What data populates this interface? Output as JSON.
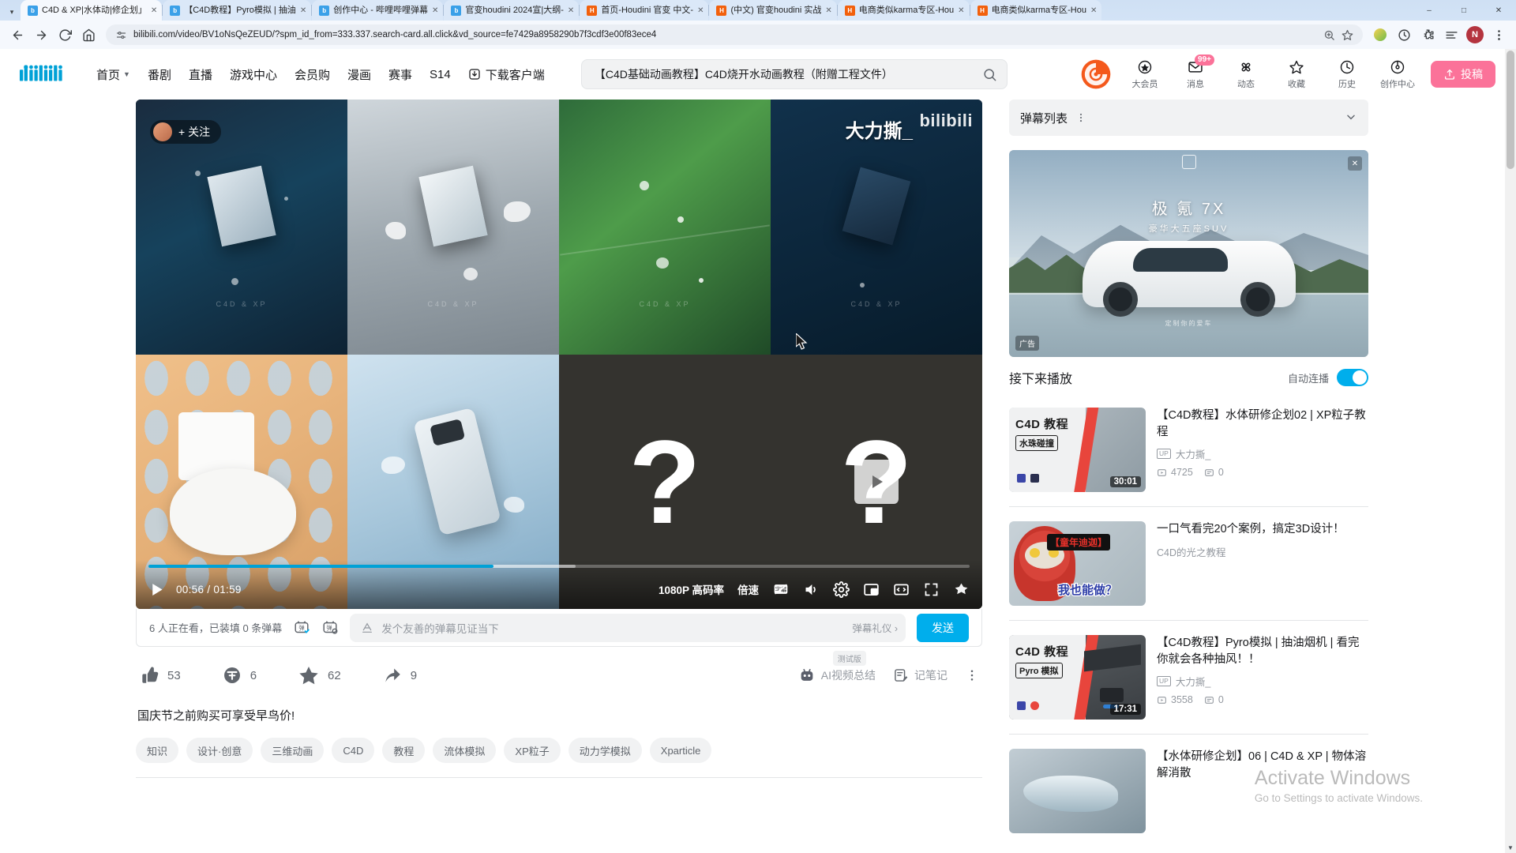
{
  "browser": {
    "tabs": [
      {
        "title": "C4D & XP|水体动|修企划」",
        "favicon": "bilibili-favicon",
        "active": true
      },
      {
        "title": "【C4D教程】Pyro模拟 | 抽油",
        "favicon": "bilibili-favicon",
        "active": false
      },
      {
        "title": "创作中心 - 哔哩哔哩弹幕",
        "favicon": "bilibili-favicon",
        "active": false
      },
      {
        "title": "官变houdini 2024宣|大纲-",
        "favicon": "bilibili-favicon",
        "active": false
      },
      {
        "title": "首页-Houdini 官变 中文-",
        "favicon": "orange-favicon",
        "active": false
      },
      {
        "title": "(中文) 官变houdini 实战",
        "favicon": "orange-favicon",
        "active": false
      },
      {
        "title": "电商类似karma专区-Hou",
        "favicon": "orange-favicon",
        "active": false
      },
      {
        "title": "电商类似karma专区-Hou",
        "favicon": "orange-favicon",
        "active": false
      }
    ],
    "url": "bilibili.com/video/BV1oNsQeZEUD/?spm_id_from=333.337.search-card.all.click&vd_source=fe7429a8958290b7f3cdf3e00f83ece4",
    "profile_initial": "N",
    "window_controls": {
      "minimize": "–",
      "maximize": "□",
      "close": "✕"
    }
  },
  "header": {
    "logo": "bilibili",
    "nav": [
      {
        "label": "首页",
        "has_caret": true
      },
      {
        "label": "番剧",
        "has_caret": false
      },
      {
        "label": "直播",
        "has_caret": false
      },
      {
        "label": "游戏中心",
        "has_caret": false
      },
      {
        "label": "会员购",
        "has_caret": false
      },
      {
        "label": "漫画",
        "has_caret": false
      },
      {
        "label": "赛事",
        "has_caret": false
      },
      {
        "label": "S14",
        "has_caret": false
      }
    ],
    "download_label": "下载客户端",
    "search_value": "【C4D基础动画教程】C4D烧开水动画教程（附赠工程文件）",
    "search_placeholder": "搜索",
    "right_items": [
      {
        "label": "大会员",
        "icon": "vip-icon",
        "badge": ""
      },
      {
        "label": "消息",
        "icon": "message-icon",
        "badge": "99+"
      },
      {
        "label": "动态",
        "icon": "dynamic-icon",
        "badge": ""
      },
      {
        "label": "收藏",
        "icon": "star-icon",
        "badge": ""
      },
      {
        "label": "历史",
        "icon": "history-icon",
        "badge": ""
      },
      {
        "label": "创作中心",
        "icon": "creator-icon",
        "badge": ""
      }
    ],
    "upload_label": "投稿",
    "avatar_initial": "N",
    "accent_pink": "#fb7299",
    "accent_blue": "#00aeec"
  },
  "player": {
    "follow_label": "关注",
    "watermark": "bilibili",
    "danmaku_overlay": "大力撕_",
    "current_time": "00:56",
    "duration": "01:59",
    "time_display": "00:56 / 01:59",
    "quality_label": "1080P 高码率",
    "speed_label": "倍速",
    "controls": [
      {
        "name": "play-button",
        "icon": "play-icon"
      },
      {
        "name": "subtitle-button",
        "icon": "subtitle-icon"
      },
      {
        "name": "volume-button",
        "icon": "volume-icon"
      },
      {
        "name": "settings-button",
        "icon": "gear-icon"
      },
      {
        "name": "pip-button",
        "icon": "pip-icon"
      },
      {
        "name": "widescreen-button",
        "icon": "widescreen-icon"
      },
      {
        "name": "fullscreen-button",
        "icon": "fullscreen-icon"
      },
      {
        "name": "theater-button",
        "icon": "theater-icon"
      }
    ],
    "progress_percent": 47,
    "buffered_percent": 52,
    "question_mark": "?"
  },
  "danmaku_bar": {
    "status": "6 人正在看，已装填 0 条弹幕",
    "placeholder": "发个友善的弹幕见证当下",
    "etiquette": "弹幕礼仪 ›",
    "send_label": "发送",
    "font_icon": "font-A-icon"
  },
  "actions": {
    "like": {
      "label": "53",
      "icon": "thumbs-up-icon"
    },
    "coin": {
      "label": "6",
      "icon": "coin-icon"
    },
    "favorite": {
      "label": "62",
      "icon": "star-filled-icon"
    },
    "share": {
      "label": "9",
      "icon": "share-icon"
    },
    "ai_summary": {
      "label": "AI视频总结",
      "badge": "测试版",
      "icon": "robot-icon"
    },
    "note": {
      "label": "记笔记",
      "icon": "note-icon"
    },
    "more": {
      "label": "",
      "icon": "more-vertical-icon"
    }
  },
  "video": {
    "description": "国庆节之前购买可享受早鸟价!",
    "tags": [
      "知识",
      "设计·创意",
      "三维动画",
      "C4D",
      "教程",
      "流体模拟",
      "XP粒子",
      "动力学模拟",
      "Xparticle"
    ]
  },
  "sidebar": {
    "danmaku_list": {
      "title": "弹幕列表",
      "more_icon": "more-vertical-icon",
      "chevron": "chevron-down-icon"
    },
    "ad": {
      "brand": "极 氪 7X",
      "subtitle": "豪华大五座SUV",
      "flag": "广告",
      "footer": "定制你的爱车",
      "close_icon": "close-icon"
    },
    "up_next": {
      "title": "接下来播放",
      "autoplay_label": "自动连播",
      "autoplay_on": true
    },
    "recommendations": [
      {
        "title": "【C4D教程】水体研修企划02 | XP粒子教程",
        "up": "大力撕_",
        "views": "4725",
        "comments": "0",
        "duration": "30:01",
        "thumb_badge_line1": "C4D 教程",
        "thumb_badge_line2": "水珠碰撞",
        "has_stats": true
      },
      {
        "title": "一口气看完20个案例，搞定3D设计！",
        "subtitle": "C4D的光之教程",
        "thumb_badge_line1": "【童年迪迦】",
        "thumb_badge_line2": "我也能做？",
        "has_stats": false
      },
      {
        "title": "【C4D教程】Pyro模拟 | 抽油烟机 | 看完你就会各种抽风！！",
        "up": "大力撕_",
        "views": "3558",
        "comments": "0",
        "duration": "17:31",
        "thumb_badge_line1": "C4D 教程",
        "thumb_badge_line2": "Pyro 模拟",
        "has_stats": true
      },
      {
        "title": "【水体研修企划】06 | C4D & XP | 物体溶解消散",
        "up": "",
        "views": "",
        "comments": "",
        "duration": "",
        "thumb_badge_line1": "",
        "thumb_badge_line2": "",
        "has_stats": false
      }
    ]
  },
  "watermark": {
    "line1": "Activate Windows",
    "line2": "Go to Settings to activate Windows."
  }
}
